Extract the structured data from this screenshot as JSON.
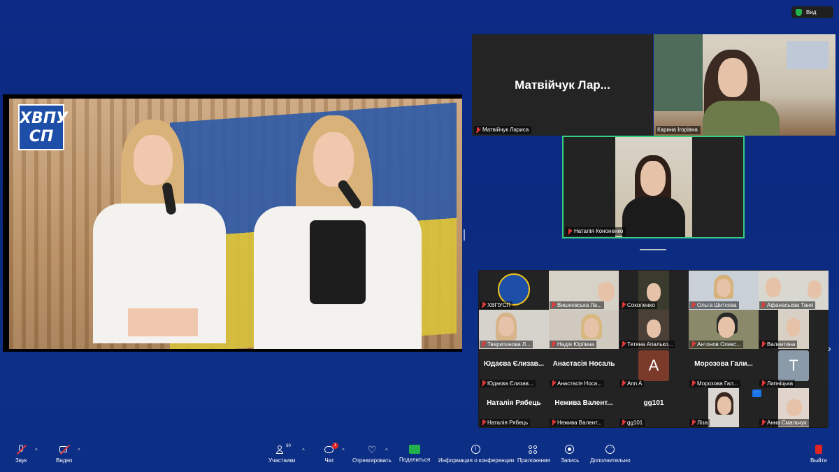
{
  "top": {
    "view_label": "Вид"
  },
  "share": {
    "logo_line1": "ХВПУ",
    "logo_line2": "СП"
  },
  "speakers": {
    "tile1_big_name": "Матвійчук Лар...",
    "tile1_name": "Матвійчук Лариса",
    "tile2_name": "Карина Ігорівна",
    "tile3_name": "Наталія Кононенко"
  },
  "gallery": {
    "row1": [
      "ХВПУСП",
      "Вишнєвська Ла...",
      "Соколенко",
      "Ольга Шитєєва",
      "Афанасьєва Таня"
    ],
    "row2": [
      "Тверитинова Л...",
      "Надія Юріївна",
      "Тетяна Апалько...",
      "Антонов Олекс...",
      "Валентина"
    ],
    "row3_titles": [
      "Юдаєва Єлизав...",
      "Анастасія Носаль",
      "",
      "Морозова  Гали...",
      ""
    ],
    "row3": [
      "Юдаєва Єлизав...",
      "Анастасія Носа...",
      "Ann A",
      "Морозова Гал...",
      "Липніцька"
    ],
    "row3_letters": {
      "c3": "A",
      "c5": "T"
    },
    "row4_titles": [
      "Наталія Рябець",
      "Нежива  Валент...",
      "gg101",
      "",
      ""
    ],
    "row4": [
      "Наталія Рябець",
      "Нежива Валент...",
      "gg101",
      "Ліза",
      "Анна Смальчук"
    ],
    "more": "···"
  },
  "toolbar": {
    "audio": "Звук",
    "video": "Видео",
    "participants": "Участники",
    "participants_count": "60",
    "chat": "Чат",
    "chat_badge": "1",
    "react": "Отреагировать",
    "share": "Поделиться",
    "info": "Информация о конференции",
    "apps": "Приложения",
    "record": "Запись",
    "more": "Дополнительно",
    "leave": "Выйти"
  },
  "colors": {
    "background": "#0c2b83",
    "active_speaker": "#35d07f",
    "share_green": "#22b14c",
    "mute_red": "#e23a3a",
    "letter_a_bg": "#7a3b2a",
    "letter_t_bg": "#8a9aa8"
  }
}
